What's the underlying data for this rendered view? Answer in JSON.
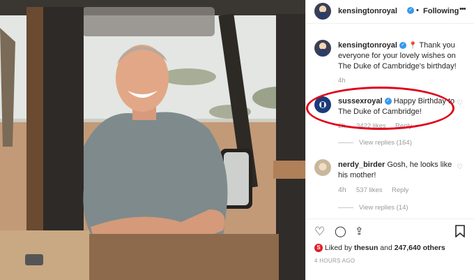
{
  "header": {
    "username": "kensingtonroyal",
    "verified_icon": "check",
    "separator": "•",
    "follow_status": "Following",
    "menu_icon": "•••"
  },
  "caption": {
    "username": "kensingtonroyal",
    "pin_icon": "📍",
    "text": "Thank you everyone for your lovely wishes on The Duke of Cambridge's birthday!",
    "age": "4h"
  },
  "comments": [
    {
      "username": "sussexroyal",
      "text": "Happy Birthday to The Duke of Cambridge!",
      "age": "2h",
      "likes": "3422 likes",
      "reply": "Reply",
      "view_replies": "View replies (164)"
    },
    {
      "username": "nerdy_birder",
      "text": "Gosh, he looks like his mother!",
      "age": "4h",
      "likes": "537 likes",
      "reply": "Reply",
      "view_replies": "View replies (14)"
    }
  ],
  "actions": {
    "heart": "♡",
    "comment": "◯",
    "share": "⇪",
    "save": "⌑"
  },
  "likes": {
    "liked_by": "Liked by",
    "user": "thesun",
    "and": "and",
    "count": "247,640 others"
  },
  "timestamp": "4 HOURS AGO",
  "colors": {
    "verified": "#3897f0",
    "highlight": "#e0001a",
    "muted": "#999999"
  }
}
